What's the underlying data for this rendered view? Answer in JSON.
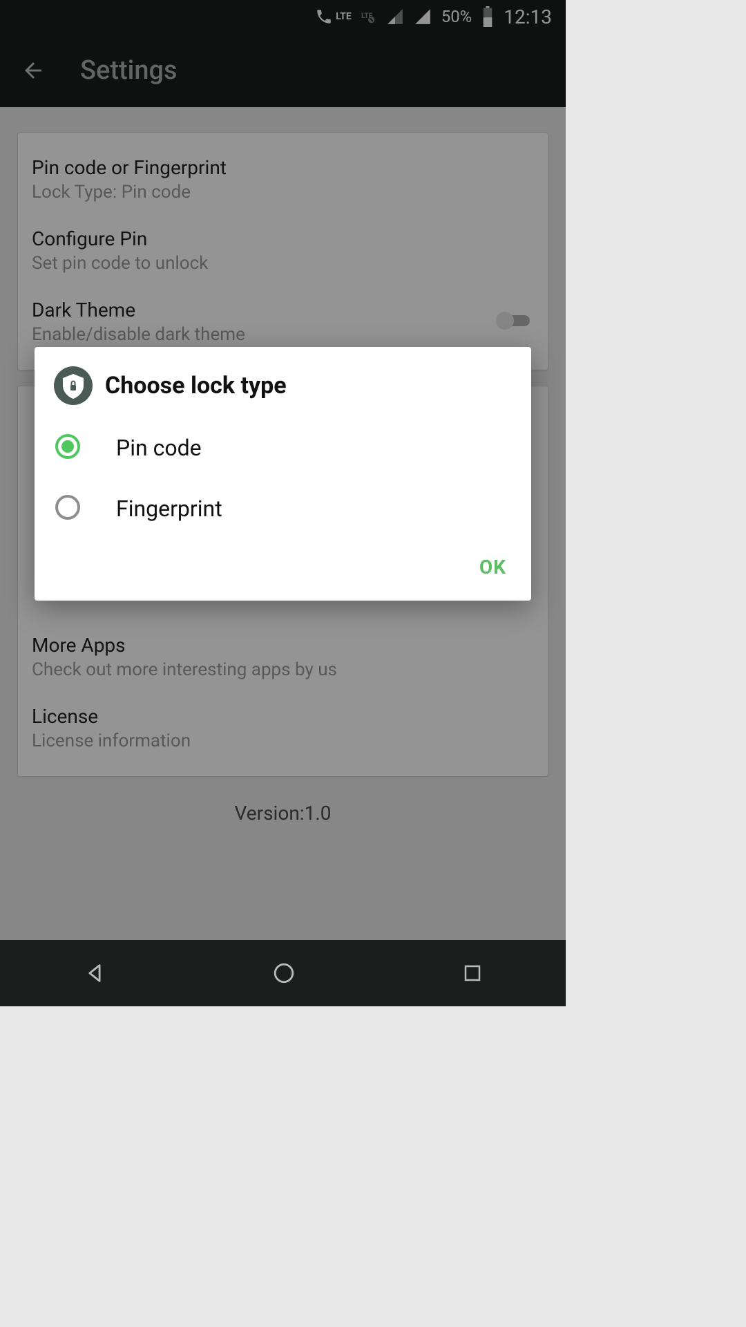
{
  "statusbar": {
    "lte_label": "LTE",
    "battery_pct": "50%",
    "time": "12:13"
  },
  "appbar": {
    "title": "Settings"
  },
  "card1": {
    "pin_fp": {
      "title": "Pin code or Fingerprint",
      "subtitle": "Lock Type: Pin code"
    },
    "configure": {
      "title": "Configure Pin",
      "subtitle": "Set pin code to unlock"
    },
    "dark": {
      "title": "Dark Theme",
      "subtitle": "Enable/disable dark theme"
    }
  },
  "card2": {
    "more_apps": {
      "title": "More Apps",
      "subtitle": "Check out more interesting apps by us"
    },
    "license": {
      "title": "License",
      "subtitle": "License information"
    }
  },
  "version": "Version:1.0",
  "dialog": {
    "title": "Choose lock type",
    "options": {
      "pin": "Pin code",
      "fp": "Fingerprint"
    },
    "ok": "OK"
  }
}
